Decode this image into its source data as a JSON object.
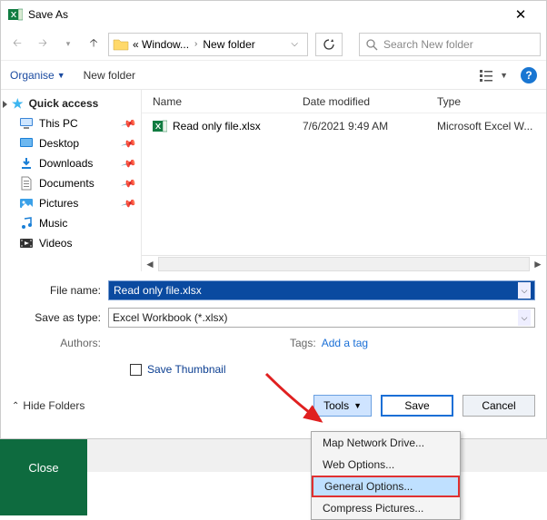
{
  "window": {
    "title": "Save As"
  },
  "nav": {
    "path_prefix": "« Window...",
    "path_current": "New folder",
    "search_placeholder": "Search New folder"
  },
  "toolbar": {
    "organise": "Organise",
    "new_folder": "New folder"
  },
  "sidebar": {
    "items": [
      {
        "label": "Quick access"
      },
      {
        "label": "This PC"
      },
      {
        "label": "Desktop"
      },
      {
        "label": "Downloads"
      },
      {
        "label": "Documents"
      },
      {
        "label": "Pictures"
      },
      {
        "label": "Music"
      },
      {
        "label": "Videos"
      }
    ]
  },
  "columns": {
    "name": "Name",
    "date": "Date modified",
    "type": "Type"
  },
  "files": [
    {
      "name": "Read only file.xlsx",
      "date": "7/6/2021 9:49 AM",
      "type": "Microsoft Excel W..."
    }
  ],
  "form": {
    "filename_label": "File name:",
    "filename_value": "Read only file.xlsx",
    "savetype_label": "Save as type:",
    "savetype_value": "Excel Workbook (*.xlsx)",
    "authors_label": "Authors:",
    "tags_label": "Tags:",
    "add_tag": "Add a tag",
    "save_thumbnail": "Save Thumbnail"
  },
  "footer": {
    "hide_folders": "Hide Folders",
    "tools": "Tools",
    "save": "Save",
    "cancel": "Cancel"
  },
  "tools_menu": {
    "items": [
      "Map Network Drive...",
      "Web Options...",
      "General Options...",
      "Compress Pictures..."
    ]
  },
  "bottom": {
    "close": "Close"
  }
}
